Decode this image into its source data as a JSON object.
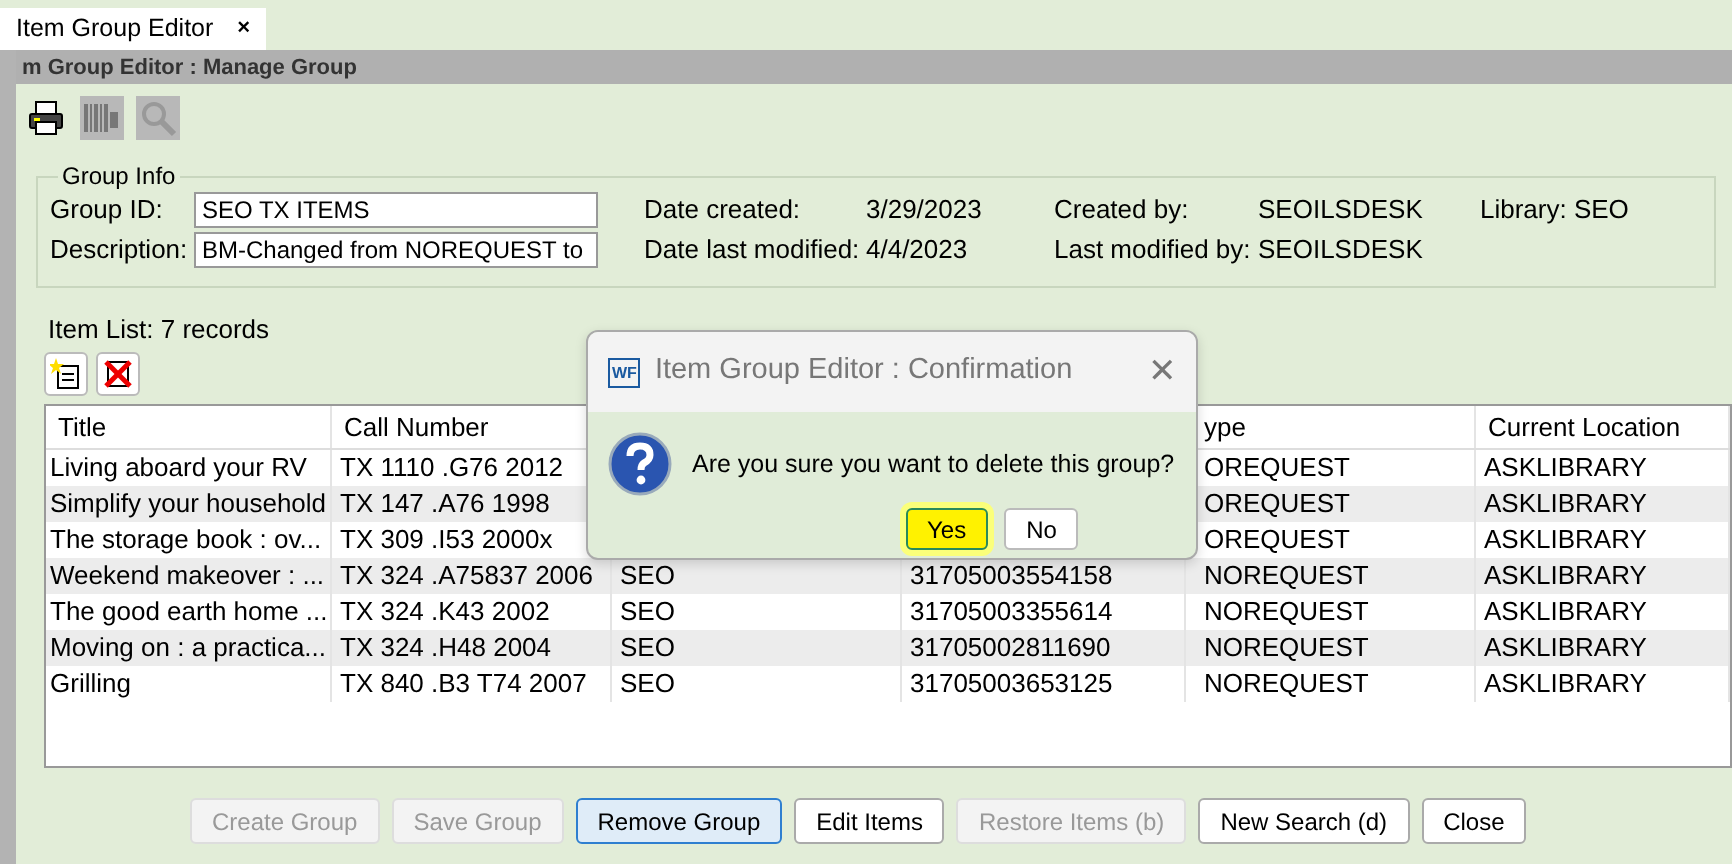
{
  "tab": {
    "label": "Item Group Editor",
    "close": "×",
    "selected": true
  },
  "window": {
    "title": "m Group Editor : Manage Group"
  },
  "toolbar": [
    {
      "kind": "print",
      "disabled": false
    },
    {
      "kind": "barcode",
      "disabled": true
    },
    {
      "kind": "search",
      "disabled": true
    }
  ],
  "group_info": {
    "legend": "Group Info",
    "fields": [
      {
        "label": "Group ID:",
        "value": "SEO TX ITEMS"
      },
      {
        "label": "Description:",
        "value": "BM-Changed from NOREQUEST to"
      }
    ],
    "details": [
      [
        {
          "label": "Date created:",
          "value": "3/29/2023"
        },
        {
          "label": "Created by:",
          "value": "SEOILSDESK"
        },
        {
          "label": "Library: SEO"
        }
      ],
      [
        {
          "label": "Date last modified:",
          "value": "4/4/2023"
        },
        {
          "label": "Last modified by:",
          "value": "SEOILSDESK"
        }
      ]
    ]
  },
  "item_list": {
    "label": "Item List: 7 records",
    "actions": [
      {
        "kind": "add"
      },
      {
        "kind": "delete"
      }
    ],
    "columns": [
      "Title",
      "Call Number",
      null,
      null,
      "ype",
      "Current Location"
    ],
    "rows": [
      [
        "Living aboard your RV",
        "TX 1110 .G76 2012",
        null,
        null,
        "OREQUEST",
        "ASKLIBRARY"
      ],
      [
        "Simplify your household",
        "TX 147 .A76 1998",
        null,
        null,
        "OREQUEST",
        "ASKLIBRARY"
      ],
      [
        "The storage book : ov...",
        "TX 309 .I53 2000x",
        null,
        null,
        "OREQUEST",
        "ASKLIBRARY"
      ],
      [
        "Weekend makeover : ...",
        "TX 324 .A75837 2006",
        "SEO",
        "31705003554158",
        "NOREQUEST",
        "ASKLIBRARY"
      ],
      [
        "The good earth home ...",
        "TX 324 .K43 2002",
        "SEO",
        "31705003355614",
        "NOREQUEST",
        "ASKLIBRARY"
      ],
      [
        "Moving on : a practica...",
        "TX 324 .H48 2004",
        "SEO",
        "31705002811690",
        "NOREQUEST",
        "ASKLIBRARY"
      ],
      [
        "Grilling",
        "TX 840 .B3 T74 2007",
        "SEO",
        "31705003653125",
        "NOREQUEST",
        "ASKLIBRARY"
      ]
    ]
  },
  "buttons": [
    {
      "label": "Create Group",
      "disabled": true,
      "focused": false
    },
    {
      "label": "Save Group",
      "disabled": true,
      "focused": false
    },
    {
      "label": "Remove Group",
      "disabled": false,
      "focused": true
    },
    {
      "label": "Edit Items",
      "disabled": false,
      "focused": false
    },
    {
      "label": "Restore Items (b)",
      "disabled": true,
      "focused": false
    },
    {
      "label": "New Search (d)",
      "disabled": false,
      "focused": false
    },
    {
      "label": "Close",
      "disabled": false,
      "focused": false
    }
  ],
  "dialog": {
    "icon_text": "WF",
    "title": "Item Group Editor : Confirmation",
    "close": "✕",
    "message": "Are you sure you want to delete this group?",
    "buttons": [
      {
        "label": "Yes",
        "highlighted": true
      },
      {
        "label": "No",
        "highlighted": false
      }
    ]
  }
}
